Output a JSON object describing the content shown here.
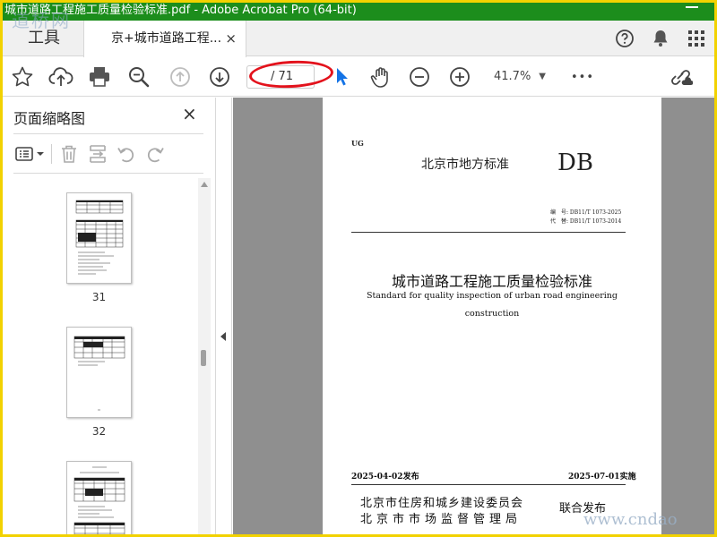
{
  "window": {
    "title": "城市道路工程施工质量检验标准.pdf - Adobe Acrobat Pro (64-bit)",
    "watermark": "道桥网"
  },
  "tabs": {
    "tools_label": "工具",
    "document_label": "京+城市道路工程...",
    "close_glyph": "×"
  },
  "toolbar": {
    "page_current": "",
    "page_total": "/ 71",
    "zoom": "41.7%",
    "more_glyph": "•••"
  },
  "sidebar": {
    "title": "页面缩略图",
    "close_glyph": "×",
    "thumbnails": [
      {
        "label": "31"
      },
      {
        "label": "32"
      },
      {
        "label": ""
      }
    ]
  },
  "document": {
    "classification": "UG",
    "standard_type": "北京市地方标准",
    "db_mark": "DB",
    "number_line": "编　号:  DB11/T 1073-2025",
    "replace_line": "代　替:  DB11/T 1073-2014",
    "title_cn": "城市道路工程施工质量检验标准",
    "title_en_line1": "Standard for quality inspection of urban road engineering",
    "title_en_line2": "construction",
    "issue_date": "2025-04-02发布",
    "effective_date": "2025-07-01实施",
    "publisher1": "北京市住房和城乡建设委员会",
    "publisher2": "北京市市场监督管理局",
    "joint_issue": "联合发布"
  },
  "footer_watermark": "www.cndao"
}
